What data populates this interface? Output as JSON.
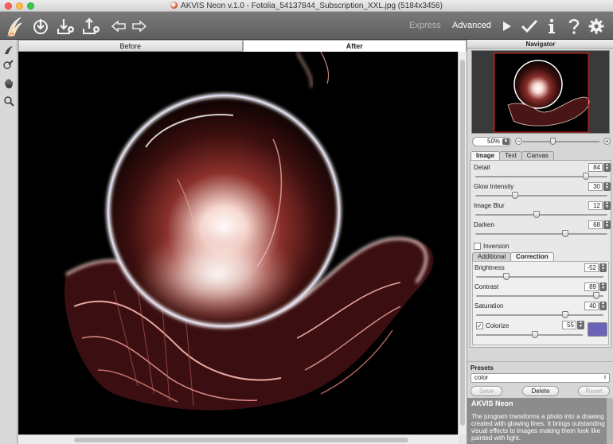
{
  "window": {
    "title": "AKVIS Neon v.1.0 - Fotolia_54137844_Subscription_XXL.jpg (5184x3456)"
  },
  "toolbar": {
    "express_label": "Express",
    "advanced_label": "Advanced"
  },
  "view_tabs": {
    "before": "Before",
    "after": "After"
  },
  "navigator": {
    "title": "Navigator",
    "zoom": "50%"
  },
  "settings_tabs": [
    "Image",
    "Text",
    "Canvas"
  ],
  "image_params": [
    {
      "label": "Detail",
      "value": 84
    },
    {
      "label": "Glow Intensity",
      "value": 30
    },
    {
      "label": "Image Blur",
      "value": 12
    },
    {
      "label": "Darken",
      "value": 68
    }
  ],
  "inversion": {
    "label": "Inversion",
    "checked": false
  },
  "sub_tabs": [
    "Additional",
    "Correction"
  ],
  "correction_params": [
    {
      "label": "Brightness",
      "value": -52
    },
    {
      "label": "Contrast",
      "value": 89
    },
    {
      "label": "Saturation",
      "value": 40
    }
  ],
  "colorize": {
    "label": "Colorize",
    "checked": true,
    "value": 55,
    "color": "#6b63b8"
  },
  "presets": {
    "title": "Presets",
    "selected": "color",
    "save": "Save",
    "delete": "Delete",
    "reset": "Reset"
  },
  "help": {
    "title": "AKVIS Neon",
    "text": "The program transforms a photo into a drawing created with glowing lines. It brings outstanding visual effects to images making them look like painted with light."
  },
  "colors": {
    "toolbar": "#6b6b6b",
    "canvas": "#000000",
    "panel": "#d6d6d6",
    "help_bg": "#8c8c8c"
  }
}
